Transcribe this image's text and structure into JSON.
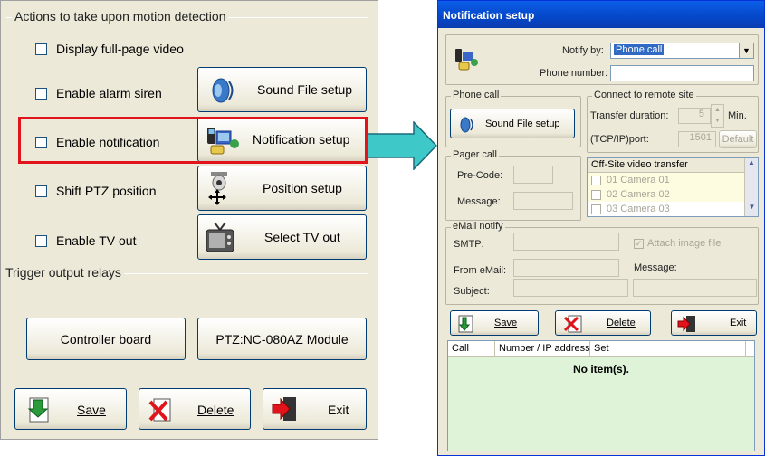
{
  "left_panel": {
    "actions_group_title": "Actions to take upon motion detection",
    "options": [
      {
        "label": "Display full-page video",
        "checked": false
      },
      {
        "label": "Enable alarm siren",
        "checked": false
      },
      {
        "label": "Enable notification",
        "checked": false
      },
      {
        "label": "Shift PTZ position",
        "checked": false
      },
      {
        "label": "Enable TV out",
        "checked": false
      }
    ],
    "buttons": {
      "sound_file_setup": "Sound File setup",
      "notification_setup": "Notification setup",
      "position_setup": "Position setup",
      "select_tv_out": "Select TV out"
    },
    "relays_group_title": "Trigger output relays",
    "relay_buttons": {
      "controller_board": "Controller board",
      "ptz_module": "PTZ:NC-080AZ Module"
    },
    "footer": {
      "save": "Save",
      "delete": "Delete",
      "exit": "Exit"
    },
    "highlight_color": "#e0141a"
  },
  "arrow_color": "#3fc8c8",
  "dialog": {
    "title": "Notification setup",
    "notify_by_label": "Notify by:",
    "notify_by_value": "Phone call",
    "phone_number_label": "Phone number:",
    "phone_number_value": "",
    "phone_call_group": "Phone call",
    "sound_file_button": "Sound File setup",
    "remote_group": "Connect to remote site",
    "transfer_duration_label": "Transfer duration:",
    "transfer_duration_value": "5",
    "transfer_unit": "Min.",
    "port_label": "(TCP/IP)port:",
    "port_value": "1501",
    "default_button": "Default",
    "pager_group": "Pager call",
    "pre_code_label": "Pre-Code:",
    "message_label": "Message:",
    "offsite_header": "Off-Site video transfer",
    "cameras": [
      "01 Camera 01",
      "02 Camera 02",
      "03 Camera 03"
    ],
    "email_group": "eMail notify",
    "smtp_label": "SMTP:",
    "attach_label": "Attach image file",
    "from_label": "From eMail:",
    "email_message_label": "Message:",
    "subject_label": "Subject:",
    "save": "Save",
    "delete": "Delete",
    "exit": "Exit",
    "list_columns": [
      "Call",
      "Number / IP address",
      "Set"
    ],
    "list_empty": "No item(s).",
    "title_bg": "#0547c8",
    "list_bg": "#dff3d8"
  }
}
